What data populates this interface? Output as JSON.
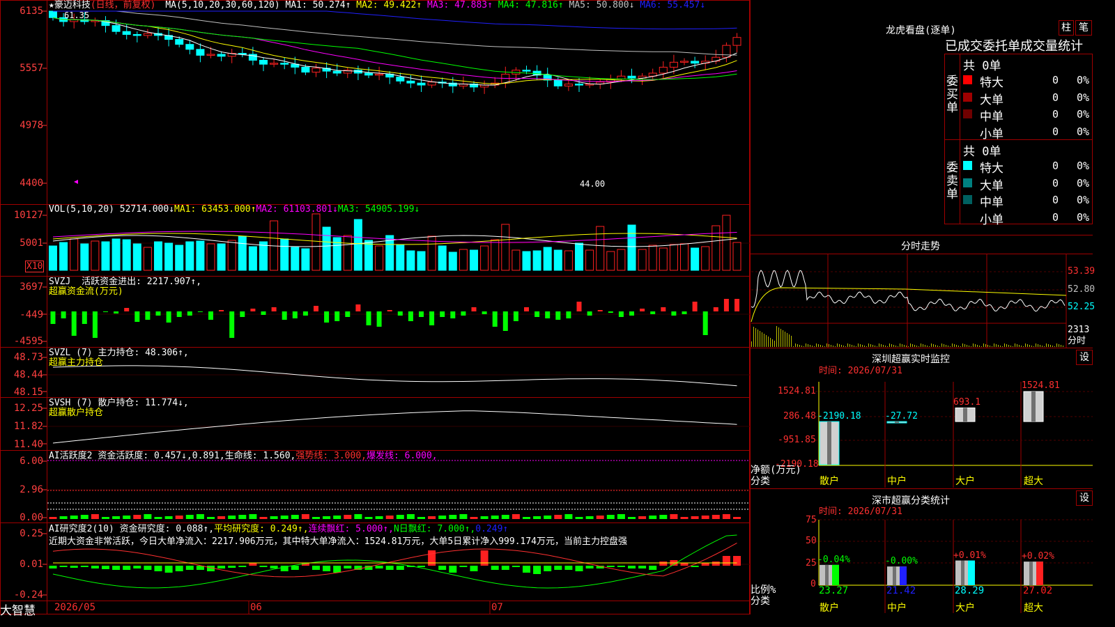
{
  "stock": {
    "name": "豪迈科技",
    "star": "★",
    "mode": "(日线，前复权)"
  },
  "colors": {
    "up": "#ff2020",
    "down": "#00ffff",
    "ma1": "#ffffff",
    "ma2": "#ffff00",
    "ma3": "#ff00ff",
    "ma4": "#00ff00",
    "ma5": "#c0c0c0",
    "ma6": "#2020ff",
    "grid": "#a00000"
  },
  "main": {
    "ma_header": "MA(5,10,20,30,60,120)",
    "ma": [
      {
        "label": "MA1: 50.274↑",
        "color": "#ffffff"
      },
      {
        "label": "MA2: 49.422↑",
        "color": "#ffff00"
      },
      {
        "label": "MA3: 47.883↑",
        "color": "#ff00ff"
      },
      {
        "label": "MA4: 47.816↑",
        "color": "#00ff00"
      },
      {
        "label": "MA5: 50.800↓",
        "color": "#c0c0c0"
      },
      {
        "label": "MA6: 55.457↓",
        "color": "#2020ff"
      }
    ],
    "yaxis": [
      "6135",
      "5557",
      "4978",
      "4400"
    ],
    "high_label": "61.35",
    "low_label": "44.00"
  },
  "vol": {
    "header": "VOL(5,10,20)",
    "value": "52714.000↓",
    "ma1": "MA1: 63453.000↑",
    "ma2": "MA2: 61103.801↓",
    "ma3": "MA3: 54905.199↓",
    "yaxis": [
      "10127",
      "5001"
    ],
    "unit": "X10"
  },
  "svzj": {
    "header": "SVZJ",
    "line1": "活跃资金进出: 2217.907↑,",
    "line2": "超赢资金流(万元)",
    "yaxis": [
      "3697",
      "-449",
      "-4595"
    ]
  },
  "svzl": {
    "header": "SVZL (7)",
    "line1": "主力持仓: 48.306↑,",
    "line2": "超赢主力持仓",
    "yaxis": [
      "48.73",
      "48.44",
      "48.15"
    ]
  },
  "svsh": {
    "header": "SVSH (7)",
    "line1": "散户持仓: 11.774↓,",
    "line2": "超赢散户持仓",
    "yaxis": [
      "12.25",
      "11.82",
      "11.40"
    ]
  },
  "ai1": {
    "header": "AI活跃度2",
    "a": "资金活跃度: 0.457↓,",
    "b": "0.891,",
    "c": "生命线: 1.560,",
    "d": "强势线: 3.000,",
    "e": "爆发线: 6.000,",
    "yaxis": [
      "6.00",
      "2.96",
      "0.00"
    ]
  },
  "ai2": {
    "header": "AI研究度2(10)",
    "a": "资金研究度: 0.088↑,",
    "b": "平均研究度: 0.249↑,",
    "c": "连续飘红: 5.000↑,",
    "d": "N日飘红: 7.000↑,",
    "e": "0.249↑",
    "comment": "近期大资金非常活跃，今日大单净流入：2217.906万元，其中特大单净流入：1524.81万元，大单5日累计净入999.174万元，当前主力控盘强",
    "yaxis": [
      "0.25",
      "0.01",
      "-0.24"
    ]
  },
  "bottom": {
    "brand": "大智慧",
    "dates": [
      "2026/05",
      "06",
      "07"
    ]
  },
  "lhb": {
    "title": "龙虎看盘(逐单)",
    "btn1": "柱",
    "btn2": "笔",
    "tabs": "已成交委托单成交量统计",
    "buy_label": "委买单",
    "sell_label": "委卖单",
    "buy_total": "共 0单",
    "sell_total": "共 0单",
    "buy_rows": [
      {
        "name": "特大",
        "count": "0",
        "pct": "0%",
        "color": "#ff0000"
      },
      {
        "name": "大单",
        "count": "0",
        "pct": "0%",
        "color": "#a00000"
      },
      {
        "name": "中单",
        "count": "0",
        "pct": "0%",
        "color": "#700000"
      },
      {
        "name": "小单",
        "count": "0",
        "pct": "0%",
        "color": "#000000"
      }
    ],
    "sell_rows": [
      {
        "name": "特大",
        "count": "0",
        "pct": "0%",
        "color": "#00ffff"
      },
      {
        "name": "大单",
        "count": "0",
        "pct": "0%",
        "color": "#008080"
      },
      {
        "name": "中单",
        "count": "0",
        "pct": "0%",
        "color": "#006060"
      },
      {
        "name": "小单",
        "count": "0",
        "pct": "0%",
        "color": "#000000"
      }
    ]
  },
  "intraday": {
    "title": "分时走势",
    "yaxis": [
      "53.39",
      "52.80",
      "52.25",
      "2313"
    ],
    "unit": "分时"
  },
  "monitor": {
    "title": "深圳超赢实时监控",
    "btn": "设",
    "time": "时间: 2026/07/31",
    "yaxis": [
      "1524.81",
      "286.48",
      "-951.85",
      "-2190.18"
    ],
    "ylabel1": "净额(万元)",
    "ylabel2": "分类",
    "bars": [
      {
        "cat": "散户",
        "value": -2190.18,
        "label": "-2190.18"
      },
      {
        "cat": "中户",
        "value": -27.72,
        "label": "-27.72"
      },
      {
        "cat": "大户",
        "value": 693.1,
        "label": "693.1"
      },
      {
        "cat": "超大",
        "value": 1524.81,
        "label": "1524.81"
      }
    ]
  },
  "classify": {
    "title": "深市超赢分类统计",
    "btn": "设",
    "time": "时间: 2026/07/31",
    "yaxis": [
      "75",
      "50",
      "25",
      "0"
    ],
    "ylabel1": "比例%",
    "ylabel2": "分类",
    "bars": [
      {
        "cat": "散户",
        "value": 23.27,
        "label": "23.27",
        "change": "-0.04%",
        "color": "#00ff00"
      },
      {
        "cat": "中户",
        "value": 21.42,
        "label": "21.42",
        "change": "-0.00%",
        "color": "#2020ff"
      },
      {
        "cat": "大户",
        "value": 28.29,
        "label": "28.29",
        "change": "+0.01%",
        "color": "#00ffff"
      },
      {
        "cat": "超大",
        "value": 27.02,
        "label": "27.02",
        "change": "+0.02%",
        "color": "#ff2020"
      }
    ]
  }
}
